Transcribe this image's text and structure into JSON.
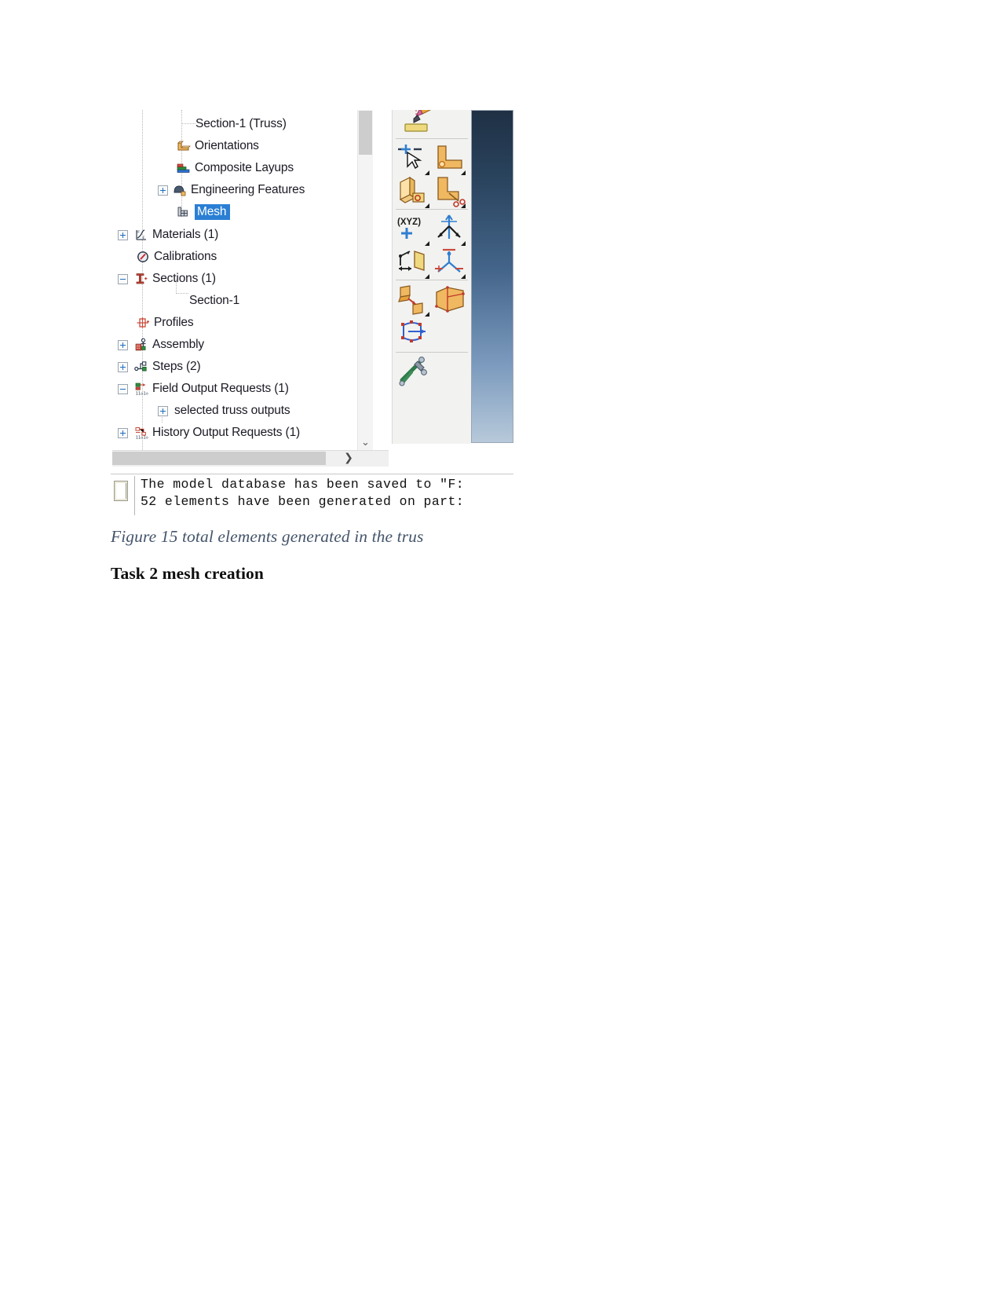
{
  "document": {
    "figure_caption": "Figure 15 total elements generated in the trus",
    "heading": "Task 2 mesh creation"
  },
  "app": {
    "model_tree": {
      "items": [
        {
          "label": "Section-1 (Truss)",
          "indent": 5,
          "expander": "none",
          "icon": "none",
          "selected": false
        },
        {
          "label": "Orientations",
          "indent": 4,
          "expander": "none",
          "icon": "orientations-icon",
          "selected": false
        },
        {
          "label": "Composite Layups",
          "indent": 4,
          "expander": "none",
          "icon": "composite-layups-icon",
          "selected": false
        },
        {
          "label": "Engineering Features",
          "indent": 4,
          "expander": "plus",
          "icon": "engineering-features-icon",
          "selected": false
        },
        {
          "label": "Mesh",
          "indent": 4,
          "expander": "none",
          "icon": "mesh-icon",
          "selected": true
        },
        {
          "label": "Materials (1)",
          "indent": 1,
          "expander": "plus",
          "icon": "materials-icon",
          "selected": false
        },
        {
          "label": "Calibrations",
          "indent": 1,
          "expander": "none",
          "icon": "calibrations-icon",
          "selected": false
        },
        {
          "label": "Sections (1)",
          "indent": 1,
          "expander": "minus",
          "icon": "sections-icon",
          "selected": false
        },
        {
          "label": "Section-1",
          "indent": 2,
          "expander": "none",
          "icon": "none",
          "selected": false
        },
        {
          "label": "Profiles",
          "indent": 1,
          "expander": "none",
          "icon": "profiles-icon",
          "selected": false
        },
        {
          "label": "Assembly",
          "indent": 1,
          "expander": "plus",
          "icon": "assembly-icon",
          "selected": false
        },
        {
          "label": "Steps (2)",
          "indent": 1,
          "expander": "plus",
          "icon": "steps-icon",
          "selected": false
        },
        {
          "label": "Field Output Requests (1)",
          "indent": 1,
          "expander": "minus",
          "icon": "field-output-icon",
          "selected": false
        },
        {
          "label": "selected truss outputs",
          "indent": 2,
          "expander": "plus",
          "icon": "none",
          "selected": false
        },
        {
          "label": "History Output Requests (1)",
          "indent": 1,
          "expander": "plus",
          "icon": "history-output-icon",
          "selected": false
        }
      ],
      "scroll": {
        "vertical_down_arrow": "⌄",
        "horizontal_right_arrow": "❯"
      }
    },
    "toolbox": {
      "tools": [
        {
          "name": "assign-section-icon",
          "has_dropdown": false
        },
        {
          "name": "assign-beam-orientation-icon",
          "has_dropdown": true
        },
        {
          "name": "assign-material-orientation-icon",
          "has_dropdown": true
        },
        {
          "name": "create-composite-layup-icon",
          "has_dropdown": true
        },
        {
          "name": "assign-skin-icon",
          "has_dropdown": true
        },
        {
          "name": "create-datum-point-icon",
          "has_dropdown": true
        },
        {
          "name": "create-datum-axis-icon",
          "has_dropdown": true
        },
        {
          "name": "create-datum-plane-icon",
          "has_dropdown": true
        },
        {
          "name": "create-datum-csys-icon",
          "has_dropdown": true
        },
        {
          "name": "create-partition-face-icon",
          "has_dropdown": true
        },
        {
          "name": "create-partition-cell-icon",
          "has_dropdown": false
        },
        {
          "name": "create-partition-edge-icon",
          "has_dropdown": false
        },
        {
          "name": "query-tools-icon",
          "has_dropdown": false
        }
      ],
      "datum_csys_label": "(XYZ)"
    },
    "message_area": {
      "lines": [
        "The model database has been saved to \"F:",
        "52 elements have been generated on part:"
      ]
    }
  },
  "colors": {
    "selection_blue": "#2a7fd4",
    "caption_text": "#44546a",
    "viewport_top": "#1f3044",
    "viewport_bottom": "#b7c9da",
    "scrollbar_thumb": "#cdcdcd"
  }
}
